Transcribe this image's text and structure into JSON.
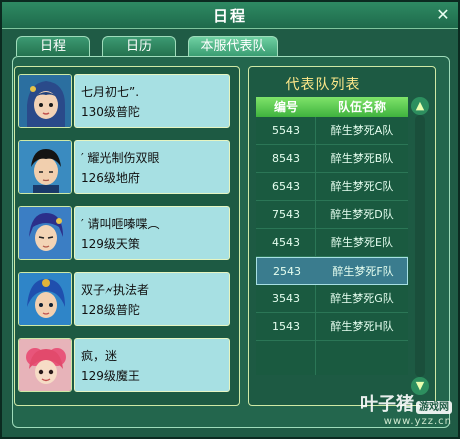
{
  "window": {
    "title": "日程"
  },
  "tabs": [
    {
      "label": "日程"
    },
    {
      "label": "日历"
    },
    {
      "label": "本服代表队"
    }
  ],
  "members": [
    {
      "name": "七月初七”.",
      "level": "130级普陀",
      "icon": "heroine-portrait"
    },
    {
      "name": "′ 耀光制伤双眼",
      "level": "126级地府",
      "icon": "hero-portrait"
    },
    {
      "name": "′ 请叫咂嗪喋︵",
      "level": "129级天策",
      "icon": "hero-portrait"
    },
    {
      "name": "双子🗲执法者",
      "level": "128级普陀",
      "icon": "heroine-portrait"
    },
    {
      "name": "疯，迷",
      "level": "129级魔王",
      "icon": "heroine-portrait"
    }
  ],
  "team_list": {
    "title": "代表队列表",
    "headers": [
      "编号",
      "队伍名称"
    ],
    "rows": [
      {
        "id": "5543",
        "team": "醉生梦死A队"
      },
      {
        "id": "8543",
        "team": "醉生梦死B队"
      },
      {
        "id": "6543",
        "team": "醉生梦死C队"
      },
      {
        "id": "7543",
        "team": "醉生梦死D队"
      },
      {
        "id": "4543",
        "team": "醉生梦死E队"
      },
      {
        "id": "2543",
        "team": "醉生梦死F队",
        "selected": true
      },
      {
        "id": "3543",
        "team": "醉生梦死G队"
      },
      {
        "id": "1543",
        "team": "醉生梦死H队"
      }
    ]
  },
  "watermark": {
    "brand": "叶子猪",
    "tag": "游戏网",
    "url": "www.yzz.cn"
  },
  "colors": {
    "accent": "#3fb33e",
    "info_card": "#a7e0e3",
    "title_text": "#ffe98a"
  }
}
